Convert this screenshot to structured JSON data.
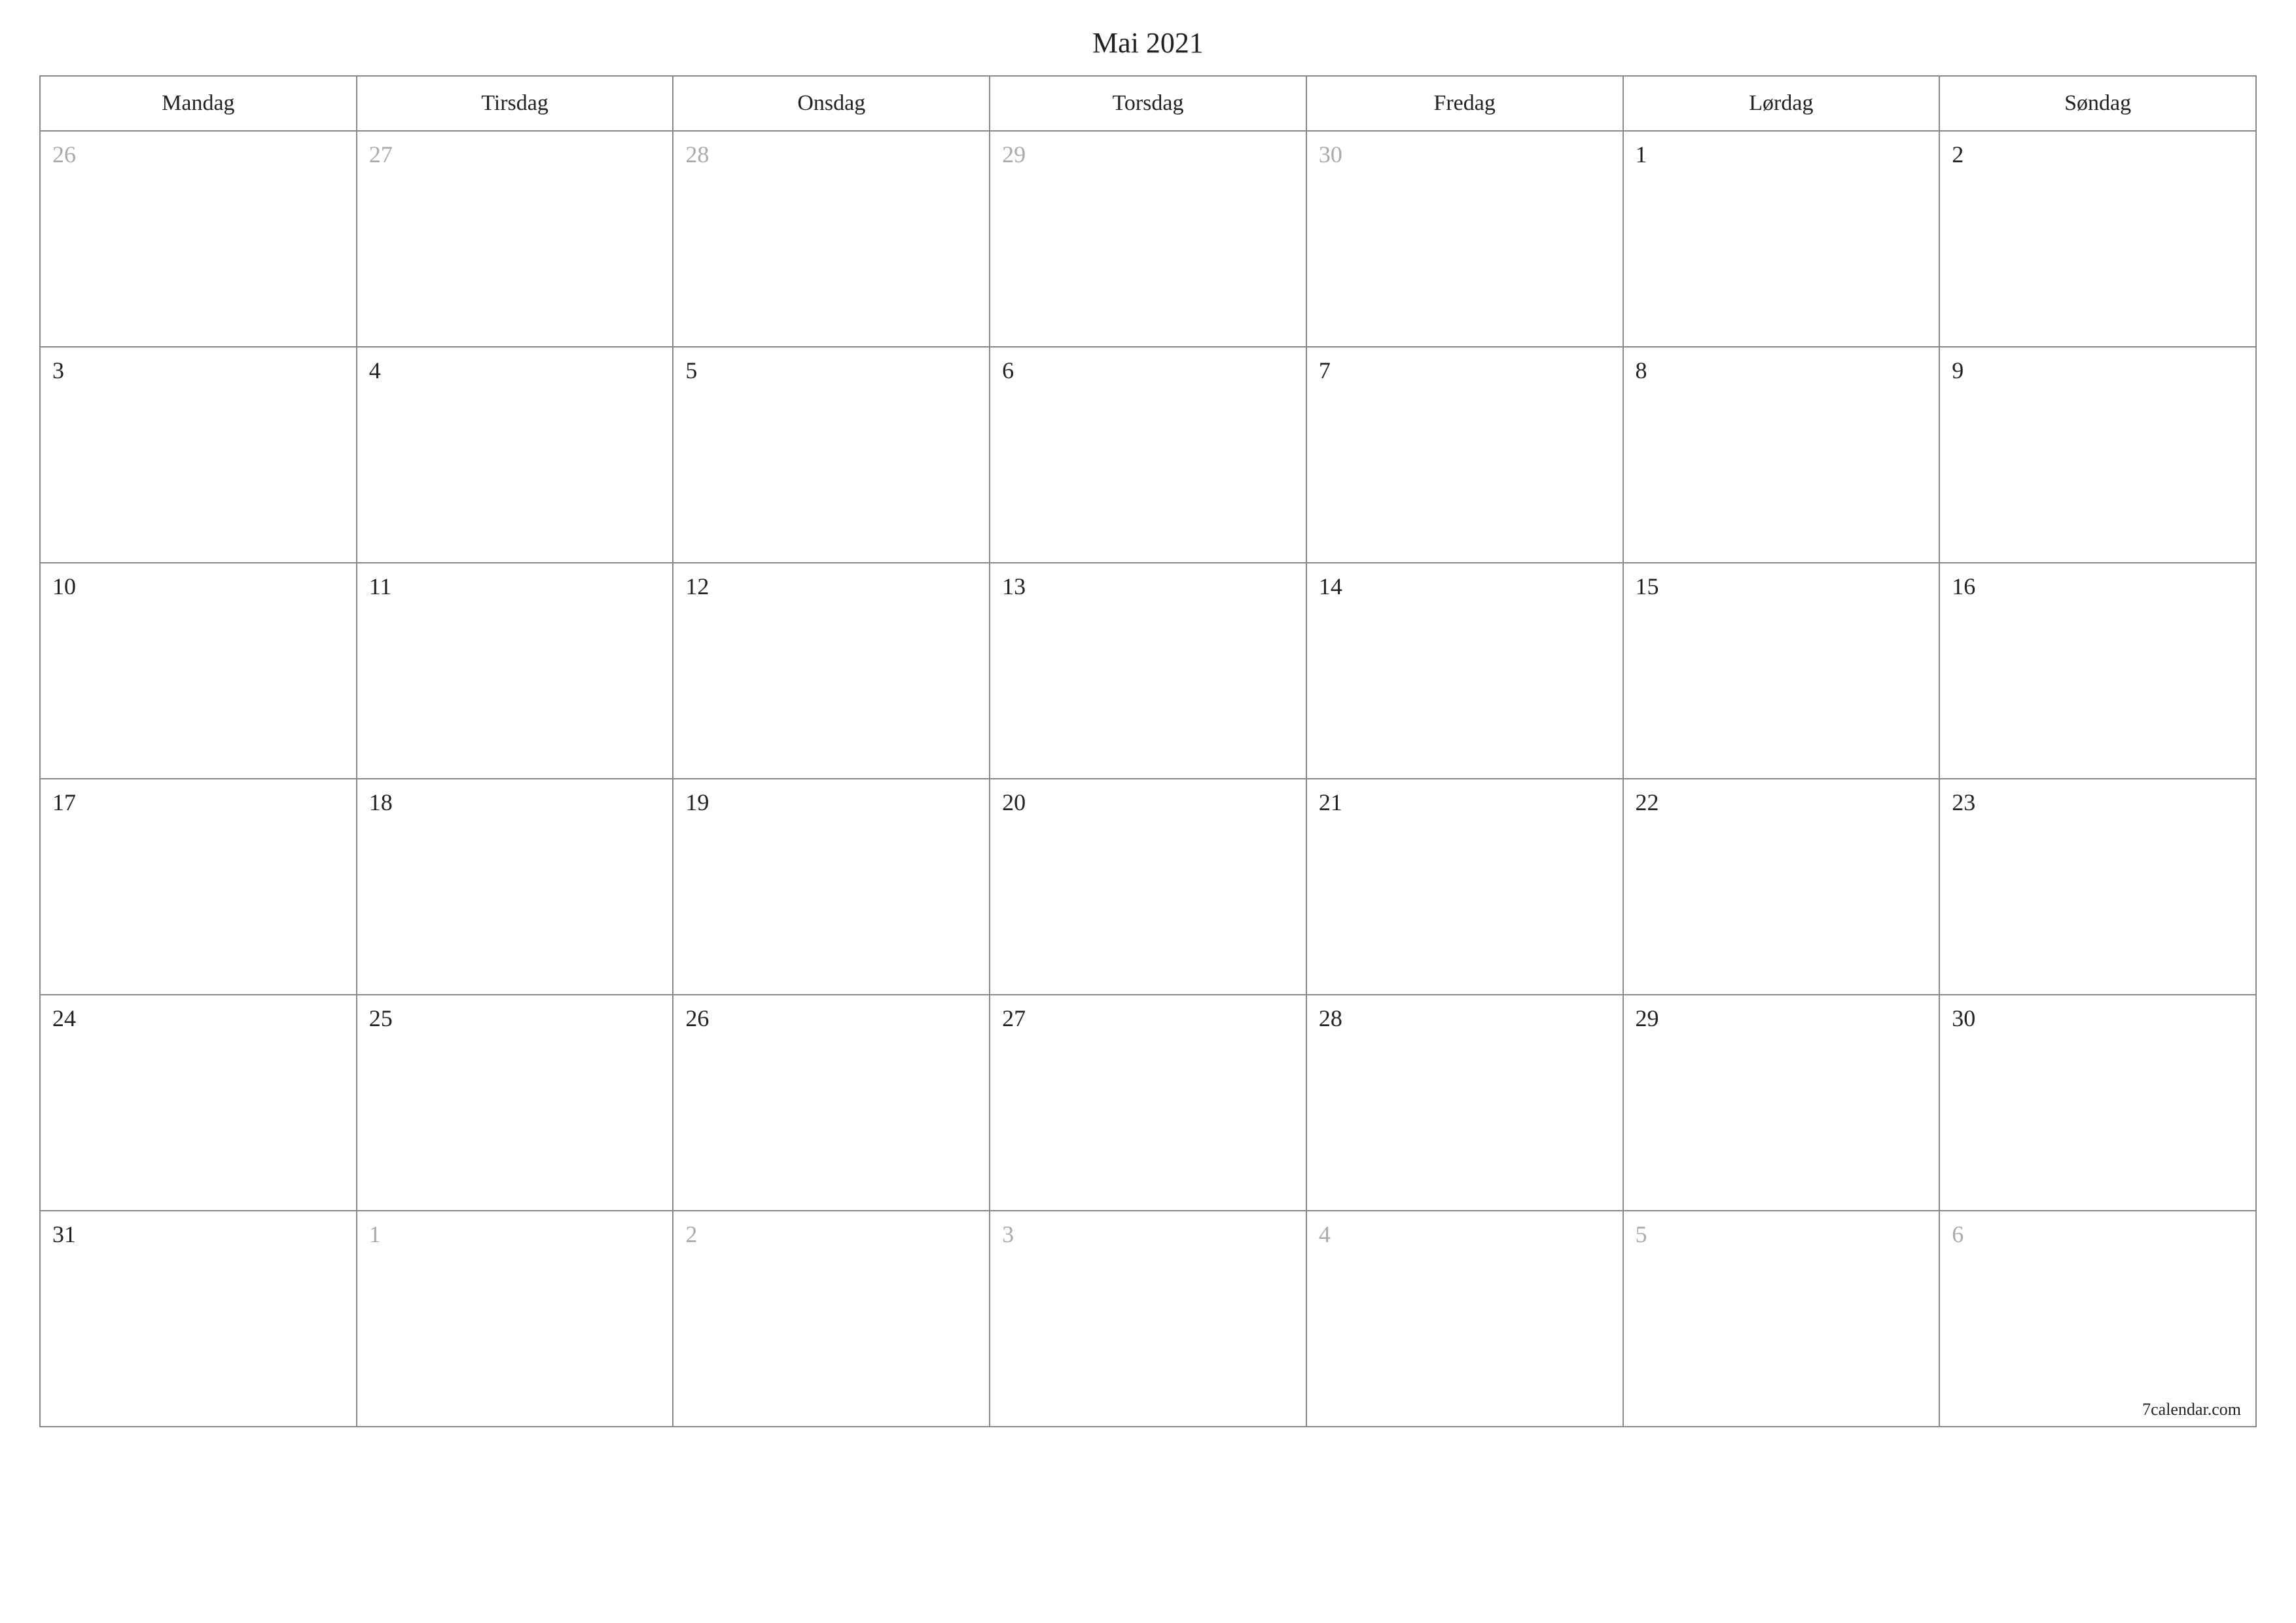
{
  "title": "Mai 2021",
  "weekdays": [
    "Mandag",
    "Tirsdag",
    "Onsdag",
    "Torsdag",
    "Fredag",
    "Lørdag",
    "Søndag"
  ],
  "weeks": [
    [
      {
        "day": "26",
        "other": true
      },
      {
        "day": "27",
        "other": true
      },
      {
        "day": "28",
        "other": true
      },
      {
        "day": "29",
        "other": true
      },
      {
        "day": "30",
        "other": true
      },
      {
        "day": "1",
        "other": false
      },
      {
        "day": "2",
        "other": false
      }
    ],
    [
      {
        "day": "3",
        "other": false
      },
      {
        "day": "4",
        "other": false
      },
      {
        "day": "5",
        "other": false
      },
      {
        "day": "6",
        "other": false
      },
      {
        "day": "7",
        "other": false
      },
      {
        "day": "8",
        "other": false
      },
      {
        "day": "9",
        "other": false
      }
    ],
    [
      {
        "day": "10",
        "other": false
      },
      {
        "day": "11",
        "other": false
      },
      {
        "day": "12",
        "other": false
      },
      {
        "day": "13",
        "other": false
      },
      {
        "day": "14",
        "other": false
      },
      {
        "day": "15",
        "other": false
      },
      {
        "day": "16",
        "other": false
      }
    ],
    [
      {
        "day": "17",
        "other": false
      },
      {
        "day": "18",
        "other": false
      },
      {
        "day": "19",
        "other": false
      },
      {
        "day": "20",
        "other": false
      },
      {
        "day": "21",
        "other": false
      },
      {
        "day": "22",
        "other": false
      },
      {
        "day": "23",
        "other": false
      }
    ],
    [
      {
        "day": "24",
        "other": false
      },
      {
        "day": "25",
        "other": false
      },
      {
        "day": "26",
        "other": false
      },
      {
        "day": "27",
        "other": false
      },
      {
        "day": "28",
        "other": false
      },
      {
        "day": "29",
        "other": false
      },
      {
        "day": "30",
        "other": false
      }
    ],
    [
      {
        "day": "31",
        "other": false
      },
      {
        "day": "1",
        "other": true
      },
      {
        "day": "2",
        "other": true
      },
      {
        "day": "3",
        "other": true
      },
      {
        "day": "4",
        "other": true
      },
      {
        "day": "5",
        "other": true
      },
      {
        "day": "6",
        "other": true
      }
    ]
  ],
  "footer": "7calendar.com"
}
